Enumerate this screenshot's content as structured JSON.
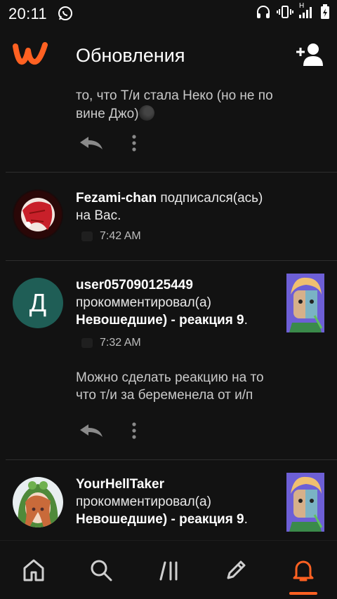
{
  "status_bar": {
    "time": "20:11",
    "icons": [
      "whatsapp-icon",
      "headphones-icon",
      "vibrate-icon",
      "signal-icon",
      "battery-icon"
    ],
    "network_label": "H"
  },
  "header": {
    "title": "Обновления",
    "logo": "wattpad-logo",
    "add_user_icon": "add-user-icon"
  },
  "colors": {
    "accent": "#ff6122",
    "background": "#121212",
    "divider": "#2e2e2e",
    "avatar_letter_bg": "#1f5e56"
  },
  "feed": {
    "partial_item": {
      "comment": "то, что Т/и стала Неко (но не по вине Джо)"
    },
    "items": [
      {
        "username": "Fezami-chan",
        "action": " подписался(ась) на Вас.",
        "time": "7:42 AM"
      },
      {
        "username": "user057090125449",
        "action": "прокомментировал(а)",
        "story": "Невошедшие) - реакция 9",
        "story_suffix": ".",
        "time": "7:32 AM",
        "avatar_letter": "Д",
        "comment": "Можно сделать реакцию на то что т/и за беременела от и/п"
      },
      {
        "username": "YourHellTaker",
        "action": "прокомментировал(а)",
        "story": "Невошедшие) - реакция 9",
        "story_suffix": "."
      }
    ]
  },
  "bottom_nav": {
    "items": [
      "home-icon",
      "search-icon",
      "library-icon",
      "write-icon",
      "notifications-icon"
    ],
    "active": "notifications-icon"
  }
}
